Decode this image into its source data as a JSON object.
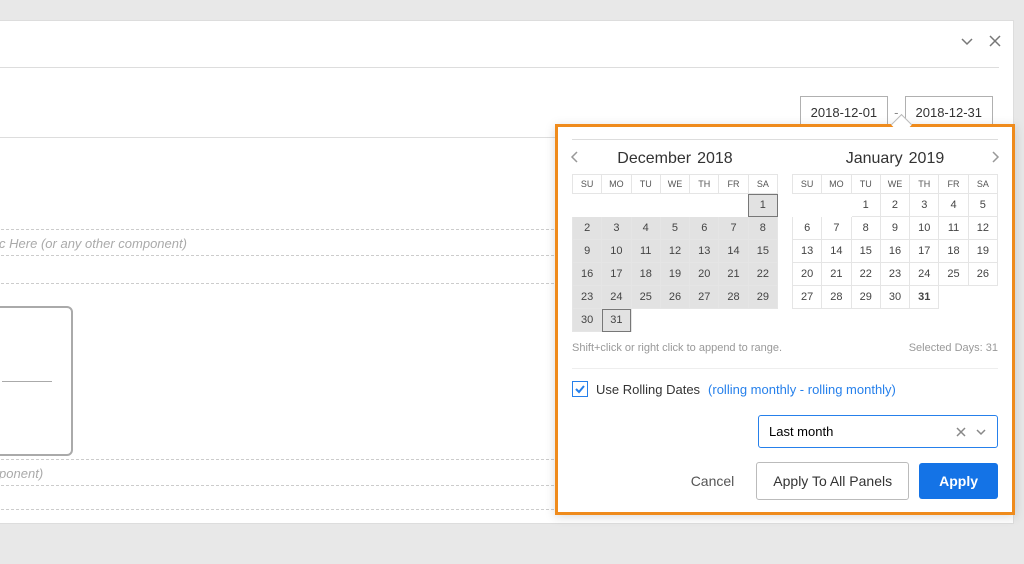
{
  "header": {},
  "dateRange": {
    "start": "2018-12-01",
    "end": "2018-12-31",
    "sep": "-"
  },
  "hints": {
    "metric": "etric Here (or any other component)",
    "component": "omponent)"
  },
  "popover": {
    "month1": {
      "name": "December",
      "year": "2018"
    },
    "month2": {
      "name": "January",
      "year": "2019"
    },
    "shiftHint": "Shift+click or right click to append to range.",
    "selectedHint": "Selected Days: 31",
    "rollingLabel": "Use Rolling Dates",
    "rollingDesc": "(rolling monthly - rolling monthly)",
    "presetValue": "Last month",
    "cancel": "Cancel",
    "applyAll": "Apply To All Panels",
    "apply": "Apply"
  }
}
